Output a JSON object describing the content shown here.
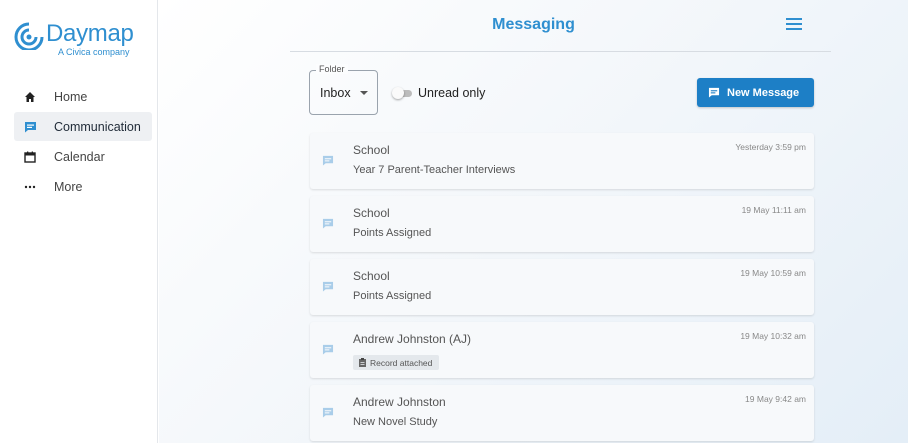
{
  "brand": {
    "name": "Daymap",
    "tagline": "A Civica company",
    "color": "#2f8fd0"
  },
  "sidebar": {
    "items": [
      {
        "label": "Home",
        "icon": "home-icon",
        "active": false
      },
      {
        "label": "Communication",
        "icon": "chat-icon",
        "active": true
      },
      {
        "label": "Calendar",
        "icon": "calendar-icon",
        "active": false
      },
      {
        "label": "More",
        "icon": "more-icon",
        "active": false
      }
    ]
  },
  "header": {
    "title": "Messaging",
    "menu_icon": "hamburger-menu-icon"
  },
  "toolbar": {
    "folder_label": "Folder",
    "folder_value": "Inbox",
    "unread_label": "Unread only",
    "unread_only": false,
    "new_message_label": "New Message",
    "accent": "#1d7fc6"
  },
  "messages": [
    {
      "sender": "School",
      "subject": "Year 7 Parent-Teacher Interviews",
      "time": "Yesterday 3:59 pm"
    },
    {
      "sender": "School",
      "subject": "Points Assigned",
      "time": "19 May 11:11 am"
    },
    {
      "sender": "School",
      "subject": "Points Assigned",
      "time": "19 May 10:59 am"
    },
    {
      "sender": "Andrew Johnston (AJ)",
      "badge": "Record attached",
      "time": "19 May 10:32 am"
    },
    {
      "sender": "Andrew Johnston",
      "subject": "New Novel Study",
      "time": "19 May 9:42 am"
    }
  ]
}
